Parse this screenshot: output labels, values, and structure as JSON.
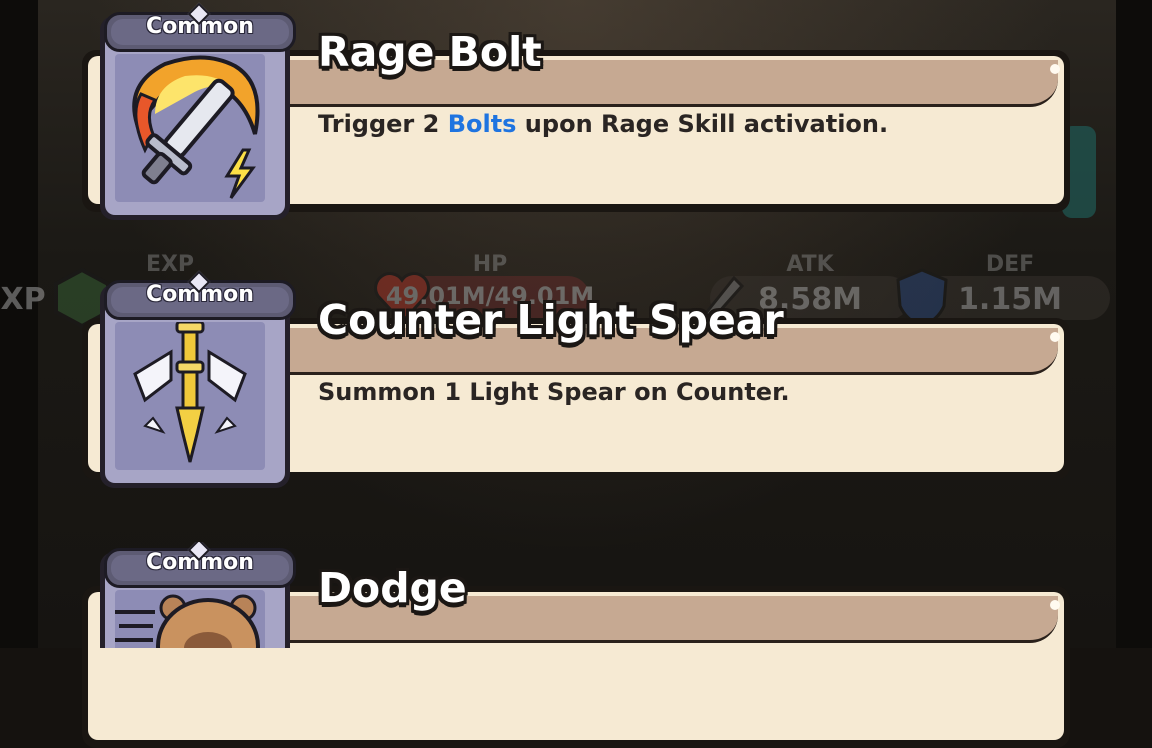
{
  "stats": [
    {
      "label": "EXP",
      "value": "EXP",
      "icon": "exp-hexagon-icon"
    },
    {
      "label": "HP",
      "value": "49.01M/49.01M",
      "icon": "heart-icon"
    },
    {
      "label": "ATK",
      "value": "8.58M",
      "icon": "sword-icon"
    },
    {
      "label": "DEF",
      "value": "1.15M",
      "icon": "shield-crown-icon"
    }
  ],
  "cards": [
    {
      "rarity": "Common",
      "title": "Rage Bolt",
      "desc_before": "Trigger 2 ",
      "desc_keyword": "Bolts",
      "desc_after": " upon Rage Skill activation.",
      "icon": "flaming-sword-lightning-icon"
    },
    {
      "rarity": "Common",
      "title": "Counter Light Spear",
      "desc_before": "Summon 1 Light Spear on Counter.",
      "desc_keyword": "",
      "desc_after": "",
      "icon": "light-spear-arrows-icon"
    },
    {
      "rarity": "Common",
      "title": "Dodge",
      "desc_before": "",
      "desc_keyword": "",
      "desc_after": "",
      "icon": "capybara-dash-icon"
    }
  ],
  "colors": {
    "card_body": "#f6ead3",
    "title_band": "#c6a992",
    "keyword": "#1f74e0",
    "rarity_common": "#6b6985",
    "icon_bg": "#8d8cb5"
  }
}
